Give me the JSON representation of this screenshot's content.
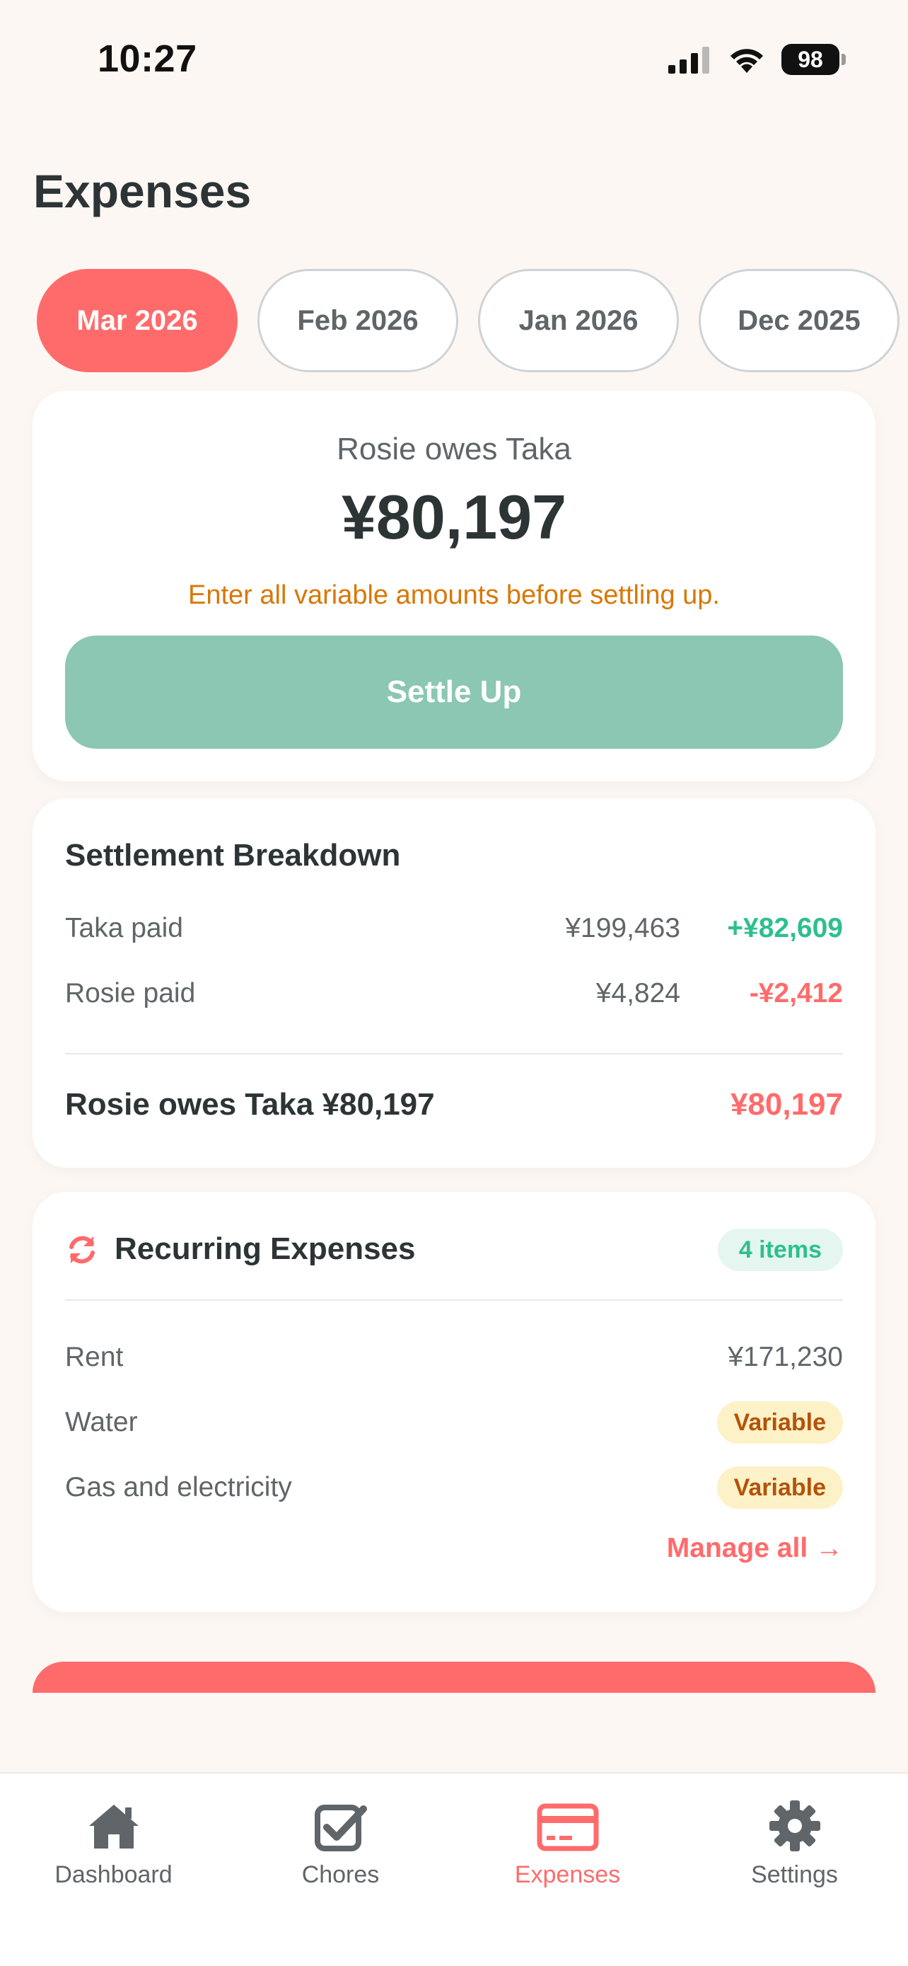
{
  "status_bar": {
    "time": "10:27",
    "battery": "98"
  },
  "page_title": "Expenses",
  "months": [
    {
      "label": "Mar 2026",
      "active": true
    },
    {
      "label": "Feb 2026",
      "active": false
    },
    {
      "label": "Jan 2026",
      "active": false
    },
    {
      "label": "Dec 2025",
      "active": false
    }
  ],
  "balance": {
    "label": "Rosie owes Taka",
    "amount": "¥80,197",
    "warning": "Enter all variable amounts before settling up.",
    "settle_label": "Settle Up"
  },
  "breakdown": {
    "title": "Settlement Breakdown",
    "rows": [
      {
        "label": "Taka paid",
        "paid": "¥199,463",
        "delta": "+¥82,609"
      },
      {
        "label": "Rosie paid",
        "paid": "¥4,824",
        "delta": "-¥2,412"
      }
    ],
    "total_label": "Rosie owes Taka ¥80,197",
    "total_value": "¥80,197"
  },
  "recurring": {
    "title": "Recurring Expenses",
    "badge": "4 items",
    "items": [
      {
        "label": "Rent",
        "value": "¥171,230"
      },
      {
        "label": "Water",
        "badge": "Variable"
      },
      {
        "label": "Gas and electricity",
        "badge": "Variable"
      }
    ],
    "manage_label": "Manage all →"
  },
  "tabs": [
    {
      "label": "Dashboard",
      "icon": "home-icon"
    },
    {
      "label": "Chores",
      "icon": "checkbox-icon"
    },
    {
      "label": "Expenses",
      "icon": "credit-card-icon",
      "active": true
    },
    {
      "label": "Settings",
      "icon": "gear-icon"
    }
  ],
  "colors": {
    "accent": "#ff6b6b",
    "settle_button": "#8bc7b2",
    "positive": "#2ebf8f",
    "warning": "#d97706",
    "background": "#fdf7f3"
  }
}
